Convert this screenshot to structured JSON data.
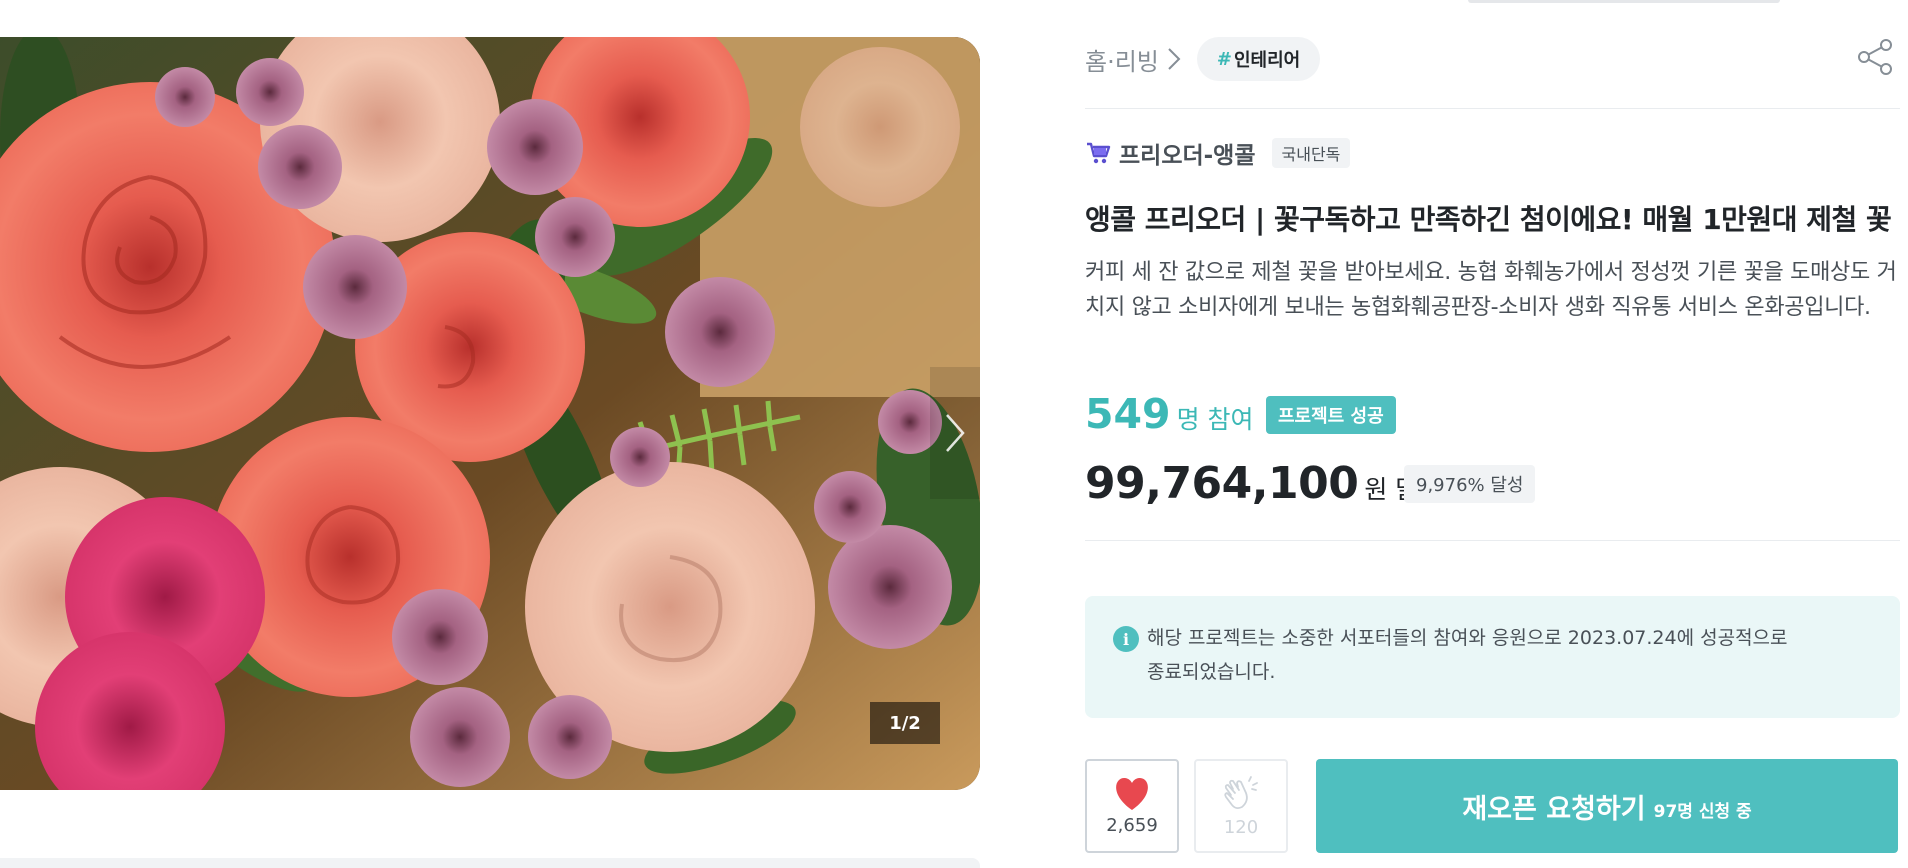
{
  "gallery": {
    "counter": "1/2",
    "image_alt": "rose and chrysanthemum bouquet photo",
    "next_icon": "chevron-right-icon"
  },
  "breadcrumb": {
    "category": "홈·리빙",
    "tag_hash": "#",
    "tag_label": "인테리어"
  },
  "maker": {
    "name": "프리오더-앵콜",
    "badge": "국내단독",
    "icon": "cart-icon"
  },
  "project": {
    "title": "앵콜 프리오더 | 꽃구독하고 만족하긴 첨이에요! 매월 1만원대 제철 꽃",
    "description": "커피 세 잔 값으로 제철 꽃을 받아보세요. 농협 화훼농가에서 정성껏 기른 꽃을 도매상도 거치지 않고 소비자에게 보내는 농협화훼공판장-소비자 생화 직유통 서비스 온화공입니다."
  },
  "stats": {
    "participants": "549",
    "participants_unit": "명 참여",
    "status_badge": "프로젝트 성공",
    "amount": "99,764,100",
    "amount_unit": "원 달성",
    "rate": "9,976% 달성"
  },
  "notice": {
    "icon_glyph": "i",
    "text": "해당 프로젝트는 소중한 서포터들의 참여와 응원으로 2023.07.24에 성공적으로 종료되었습니다."
  },
  "actions": {
    "like_count": "2,659",
    "clap_count": "120",
    "reopen_label": "재오픈 요청하기",
    "reopen_sub": "97명 신청 중"
  },
  "colors": {
    "accent": "#4fbfbf",
    "accent_text": "#3cb8b6",
    "like": "#e8484f"
  }
}
